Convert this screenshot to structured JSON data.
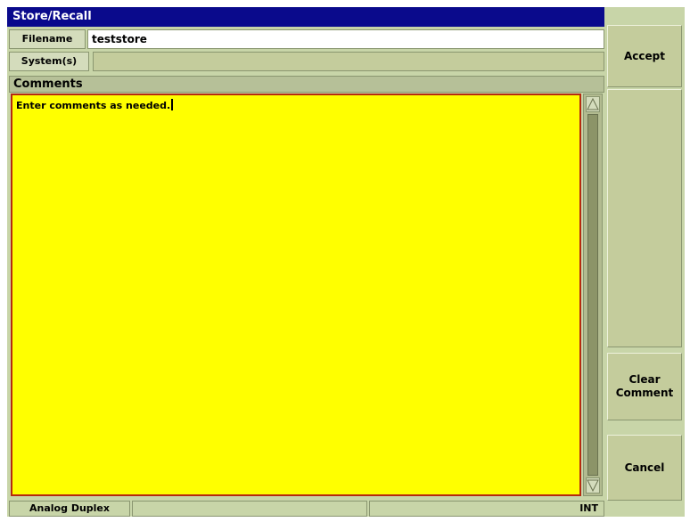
{
  "window": {
    "title": "Store/Recall"
  },
  "fields": {
    "filename_label": "Filename",
    "filename_value": "teststore",
    "systems_label": "System(s)",
    "systems_value": ""
  },
  "comments": {
    "header": "Comments",
    "text": "Enter comments as needed."
  },
  "softkeys": {
    "accept": "Accept",
    "clear_comment_line1": "Clear",
    "clear_comment_line2": "Comment",
    "cancel": "Cancel"
  },
  "status": {
    "mode": "Analog Duplex",
    "cell2": "",
    "cell3": "",
    "ref": "INT"
  },
  "colors": {
    "title_bg": "#0a0a8c",
    "panel_bg": "#c8d5a8",
    "comment_bg": "#ffff00",
    "comment_border": "#b52a10"
  },
  "icons": {
    "scroll_up": "up-triangle-icon",
    "scroll_down": "down-triangle-icon"
  }
}
